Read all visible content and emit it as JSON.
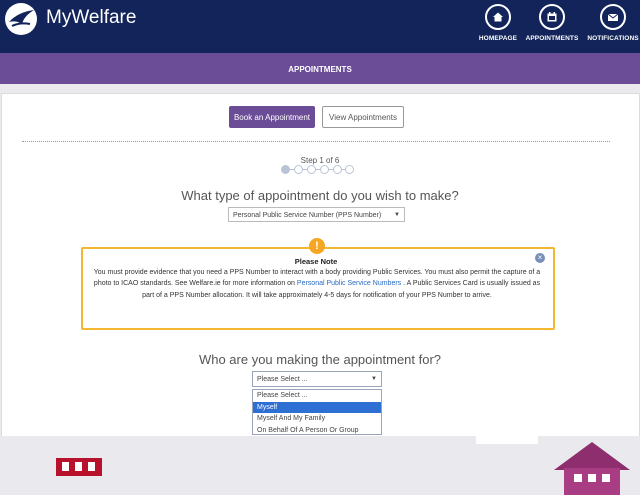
{
  "header": {
    "brand": "MyWelfare",
    "nav": [
      {
        "label": "HOMEPAGE",
        "icon": "home-icon"
      },
      {
        "label": "APPOINTMENTS",
        "icon": "calendar-icon"
      },
      {
        "label": "NOTIFICATIONS",
        "icon": "mail-icon"
      }
    ]
  },
  "subbar": {
    "title": "APPOINTMENTS"
  },
  "actions": {
    "book": "Book an Appointment",
    "view": "View Appointments"
  },
  "progress": {
    "label": "Step 1 of 6",
    "current": 1,
    "total": 6
  },
  "question1": {
    "text": "What type of appointment do you wish to make?",
    "selected": "Personal Public Service Number (PPS Number)"
  },
  "note": {
    "title": "Please Note",
    "body_before": "You must provide evidence that you need a PPS Number to interact with a body providing Public Services. You must also permit the capture of a photo to ICAO standards. See Welfare.ie for more information on ",
    "link": "Personal Public Service Numbers",
    "body_after": " . A Public Services Card is usually issued as part of a PPS Number allocation. It will take approximately 4-5 days for notification of your PPS Number to arrive."
  },
  "question2": {
    "text": "Who are you making the appointment for?",
    "selected": "Please Select ...",
    "options": [
      "Please Select ...",
      "Myself",
      "Myself And My Family",
      "On Behalf Of A Person Or Group"
    ],
    "highlighted_index": 1
  },
  "colors": {
    "header": "#12245a",
    "accent": "#6b4c97",
    "warning": "#f5b731",
    "link": "#2a6bc4"
  }
}
